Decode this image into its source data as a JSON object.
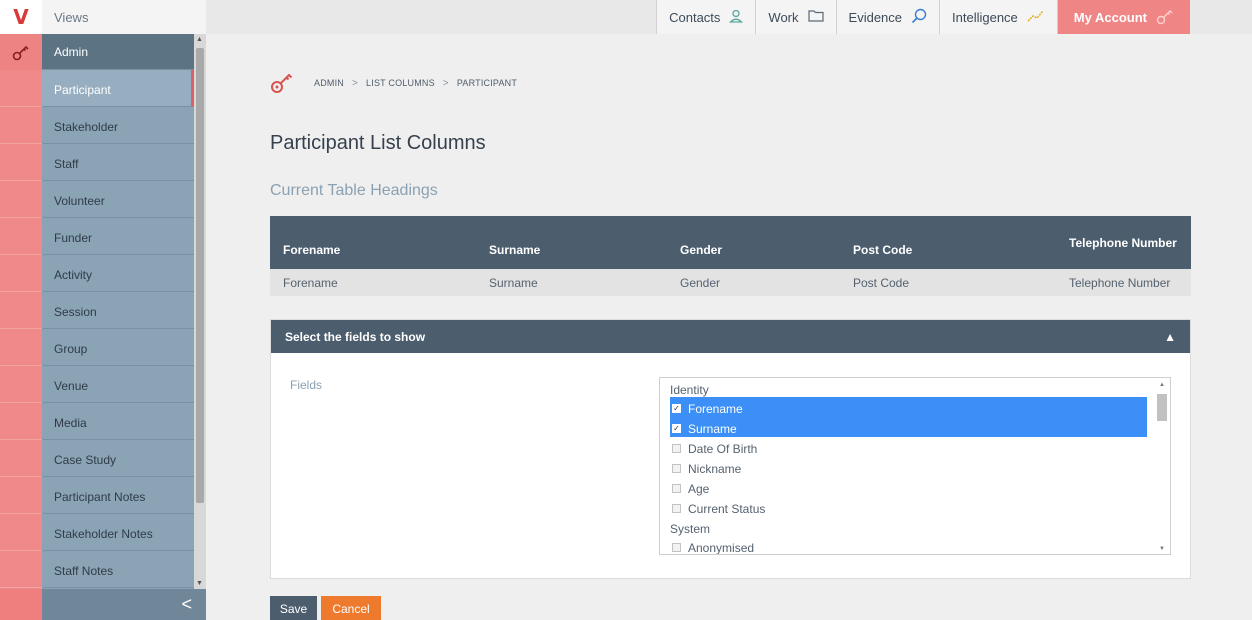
{
  "app": {
    "logo_letter": "V",
    "views_label": "Views"
  },
  "topnav": {
    "items": [
      {
        "label": "Contacts",
        "icon": "person-icon"
      },
      {
        "label": "Work",
        "icon": "folder-icon"
      },
      {
        "label": "Evidence",
        "icon": "magnifier-icon"
      },
      {
        "label": "Intelligence",
        "icon": "chart-line-icon"
      },
      {
        "label": "My Account",
        "icon": "key-icon"
      }
    ]
  },
  "sidebar": {
    "items": [
      {
        "label": "Admin"
      },
      {
        "label": "Participant"
      },
      {
        "label": "Stakeholder"
      },
      {
        "label": "Staff"
      },
      {
        "label": "Volunteer"
      },
      {
        "label": "Funder"
      },
      {
        "label": "Activity"
      },
      {
        "label": "Session"
      },
      {
        "label": "Group"
      },
      {
        "label": "Venue"
      },
      {
        "label": "Media"
      },
      {
        "label": "Case Study"
      },
      {
        "label": "Participant Notes"
      },
      {
        "label": "Stakeholder Notes"
      },
      {
        "label": "Staff Notes"
      }
    ],
    "collapse_glyph": "<"
  },
  "breadcrumb": [
    "ADMIN",
    "LIST COLUMNS",
    "PARTICIPANT"
  ],
  "breadcrumb_sep": ">",
  "page": {
    "title": "Participant List Columns",
    "subtitle": "Current Table Headings"
  },
  "table": {
    "headers": [
      "Forename",
      "Surname",
      "Gender",
      "Post Code",
      "Telephone Number"
    ],
    "row": [
      "Forename",
      "Surname",
      "Gender",
      "Post Code",
      "Telephone Number"
    ]
  },
  "panel": {
    "title": "Select the fields to show",
    "fields_label": "Fields",
    "groups": [
      {
        "name": "Identity",
        "options": [
          {
            "label": "Forename",
            "checked": true
          },
          {
            "label": "Surname",
            "checked": true
          },
          {
            "label": "Date Of Birth",
            "checked": false
          },
          {
            "label": "Nickname",
            "checked": false
          },
          {
            "label": "Age",
            "checked": false
          },
          {
            "label": "Current Status",
            "checked": false
          }
        ]
      },
      {
        "name": "System",
        "options": [
          {
            "label": "Anonymised",
            "checked": false
          }
        ]
      }
    ]
  },
  "buttons": {
    "save": "Save",
    "cancel": "Cancel"
  },
  "colors": {
    "accent": "#f08585",
    "header": "#4c5d6e",
    "selected": "#3b8ff6",
    "cancel": "#ee7a2e"
  }
}
